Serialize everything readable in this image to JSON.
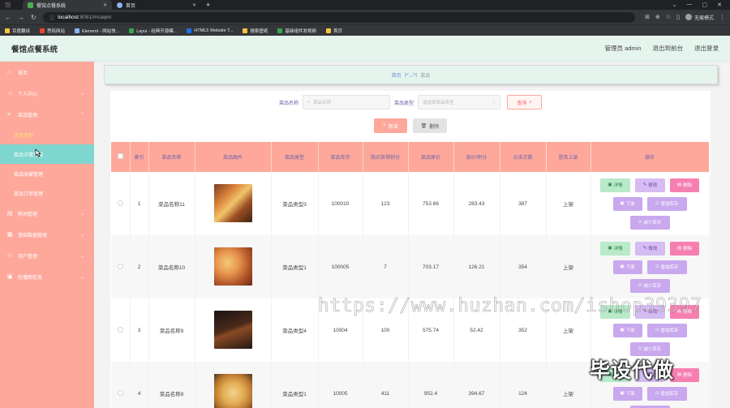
{
  "browser": {
    "tabs": [
      {
        "title": "餐馆点餐系统",
        "active": true
      },
      {
        "title": "首页",
        "active": false
      }
    ],
    "url_host": "localhost",
    "url_path": ":8081/#/caipin",
    "incognito_label": "无痕模式",
    "bookmarks": [
      "百度翻译",
      "思拓网站",
      "Element - 网站快...",
      "Layui - 经典开源模...",
      "HTML5 Website T...",
      "搜索壁纸",
      "基础组件发视频",
      "首页"
    ]
  },
  "header": {
    "title": "餐馆点餐系统",
    "admin_label": "管理员 admin",
    "back_label": "退出到前台",
    "logout_label": "退出登录"
  },
  "sidebar": {
    "items": [
      {
        "label": "首页",
        "icon": "home-icon"
      },
      {
        "label": "个人中心",
        "icon": "user-icon"
      },
      {
        "label": "菜品管理",
        "icon": "menu-icon"
      },
      {
        "label": "菜品类型",
        "sub": true,
        "state": "current"
      },
      {
        "label": "菜品详情管理",
        "sub": true,
        "state": "hover"
      },
      {
        "label": "菜品收藏管理",
        "sub": true
      },
      {
        "label": "菜品订单管理",
        "sub": true
      },
      {
        "label": "新闻管理",
        "icon": "news-icon"
      },
      {
        "label": "基础数据管理",
        "icon": "data-icon"
      },
      {
        "label": "用户管理",
        "icon": "users-icon"
      },
      {
        "label": "轮播图信息",
        "icon": "carousel-icon"
      }
    ]
  },
  "breadcrumb": {
    "home": "首页",
    "sep": "(•'◡'•)",
    "current": "菜品"
  },
  "search": {
    "name_label": "菜品名称",
    "name_placeholder": "菜品名称",
    "type_label": "菜品类型",
    "type_placeholder": "请选择菜品类型",
    "query_label": "查询"
  },
  "actions": {
    "add_label": "新增",
    "delete_label": "删除"
  },
  "table": {
    "headers": [
      "索引",
      "菜品名称",
      "菜品图片",
      "菜品类型",
      "菜品库存",
      "购买获得积分",
      "菜品原价",
      "现价/积分",
      "点击次数",
      "是否上架",
      "操作"
    ],
    "op_labels": {
      "detail": "详情",
      "edit": "修改",
      "delete": "删除",
      "down": "下架",
      "add_stock": "增加库存",
      "sub_stock": "减少库存"
    },
    "rows": [
      {
        "index": "1",
        "name": "菜品名称11",
        "type": "菜品类型3",
        "stock": "100010",
        "points": "123",
        "orig_price": "753.66",
        "price": "283.43",
        "clicks": "387",
        "status": "上架"
      },
      {
        "index": "2",
        "name": "菜品名称10",
        "type": "菜品类型1",
        "stock": "100005",
        "points": "7",
        "orig_price": "703.17",
        "price": "126.21",
        "clicks": "354",
        "status": "上架"
      },
      {
        "index": "3",
        "name": "菜品名称9",
        "type": "菜品类型4",
        "stock": "10004",
        "points": "100",
        "orig_price": "575.74",
        "price": "52.42",
        "clicks": "352",
        "status": "上架"
      },
      {
        "index": "4",
        "name": "菜品名称8",
        "type": "菜品类型1",
        "stock": "10005",
        "points": "411",
        "orig_price": "952.4",
        "price": "394.67",
        "clicks": "124",
        "status": "上架"
      }
    ]
  },
  "watermark": {
    "url_text": "https://www.huzhan.com/ishop39397",
    "cn_text": "毕设代做"
  },
  "colors": {
    "sidebar": "#fea89c",
    "table_header": "#fea89c",
    "header_bg": "#e6f4ee",
    "hover_item": "#7fd6cf"
  }
}
